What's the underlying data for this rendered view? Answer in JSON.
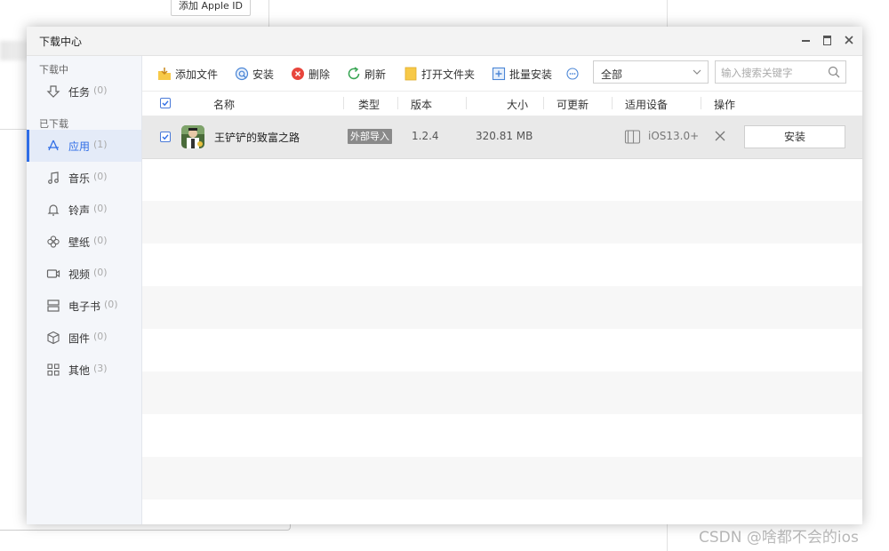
{
  "background": {
    "apple_id_button": "添加 Apple ID",
    "watermark": "CSDN @啥都不会的ios"
  },
  "window": {
    "title": "下载中心"
  },
  "sidebar": {
    "section_downloading": "下载中",
    "section_downloaded": "已下载",
    "items": [
      {
        "label": "任务",
        "count": "(0)",
        "icon": "download-icon"
      },
      {
        "label": "应用",
        "count": "(1)",
        "icon": "app-store-icon",
        "active": true
      },
      {
        "label": "音乐",
        "count": "(0)",
        "icon": "music-note-icon"
      },
      {
        "label": "铃声",
        "count": "(0)",
        "icon": "bell-icon"
      },
      {
        "label": "壁纸",
        "count": "(0)",
        "icon": "flower-icon"
      },
      {
        "label": "视频",
        "count": "(0)",
        "icon": "video-camera-icon"
      },
      {
        "label": "电子书",
        "count": "(0)",
        "icon": "book-icon"
      },
      {
        "label": "固件",
        "count": "(0)",
        "icon": "cube-icon"
      },
      {
        "label": "其他",
        "count": "(3)",
        "icon": "grid-icon"
      }
    ]
  },
  "toolbar": {
    "add_file": "添加文件",
    "install": "安装",
    "delete": "删除",
    "refresh": "刷新",
    "open_folder": "打开文件夹",
    "batch_install": "批量安装",
    "filter_value": "全部",
    "search_placeholder": "输入搜索关键字"
  },
  "table": {
    "columns": [
      "名称",
      "类型",
      "版本",
      "大小",
      "可更新",
      "适用设备",
      "操作"
    ],
    "rows": [
      {
        "checked": true,
        "name": "王铲铲的致富之路",
        "type": "外部导入",
        "version": "1.2.4",
        "size": "320.81 MB",
        "updatable": "",
        "device": "iOS13.0+",
        "action": "安装"
      }
    ]
  },
  "colors": {
    "accent": "#2f6de6",
    "sidebar_bg": "#f4f6fa",
    "sidebar_active": "#e4ebf8",
    "delete_red": "#e8453c",
    "refresh_green": "#3aa655",
    "folder_yellow": "#f7c948"
  }
}
